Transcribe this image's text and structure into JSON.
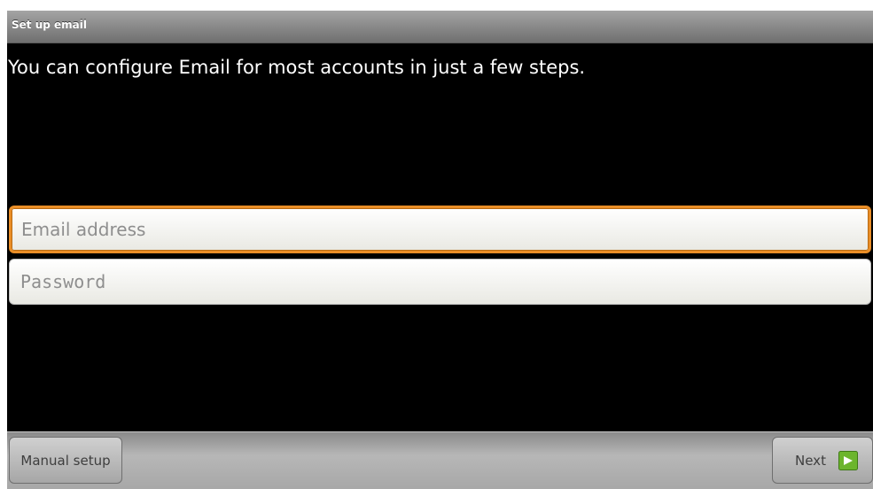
{
  "title_bar": {
    "title": "Set up email"
  },
  "main": {
    "instructions": "You can configure Email for most accounts in just a few steps."
  },
  "form": {
    "email": {
      "placeholder": "Email address",
      "value": ""
    },
    "password": {
      "placeholder": "Password",
      "value": ""
    }
  },
  "bottom_bar": {
    "manual_setup_label": "Manual setup",
    "next_label": "Next",
    "next_icon": "arrow-right-icon"
  },
  "colors": {
    "screen_background": "#000000",
    "focus_border": "#ea8e27",
    "next_icon_green": "#6cb52d"
  }
}
